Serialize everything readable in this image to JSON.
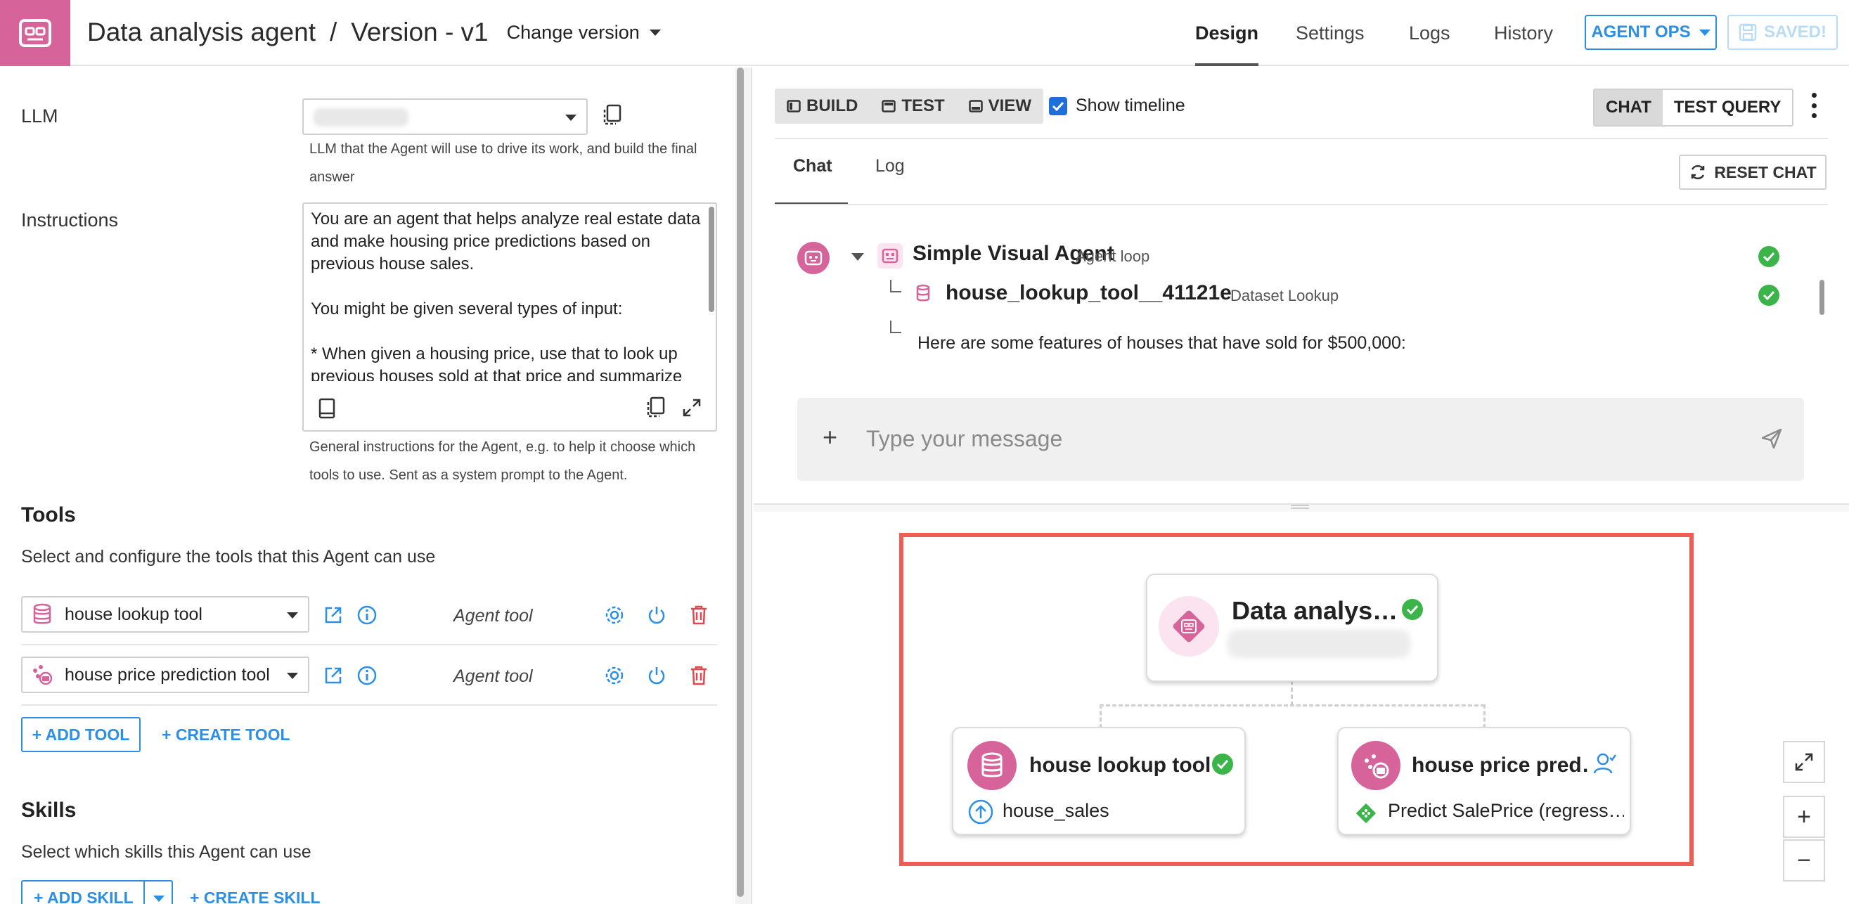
{
  "header": {
    "agent_name": "Data analysis agent",
    "separator": "/",
    "version": "Version - v1",
    "change_version": "Change version",
    "tabs": [
      {
        "label": "Design",
        "active": true
      },
      {
        "label": "Settings",
        "active": false
      },
      {
        "label": "Logs",
        "active": false
      },
      {
        "label": "History",
        "active": false
      }
    ],
    "agent_ops_label": "AGENT OPS",
    "saved_label": "SAVED!"
  },
  "form": {
    "llm_label": "LLM",
    "llm_help": "LLM that the Agent will use to drive its work, and build the final answer",
    "instructions_label": "Instructions",
    "instructions_text": "You are an agent that helps analyze real estate data and make housing price predictions based on previous house sales.\n\nYou might be given several types of input:\n\n* When given a housing price, use that to look up previous houses sold at that price and summarize",
    "instructions_help": "General instructions for the Agent, e.g. to help it choose which tools to use. Sent as a system prompt to the Agent."
  },
  "tools": {
    "title": "Tools",
    "subtitle": "Select and configure the tools that this Agent can use",
    "items": [
      {
        "name": "house lookup tool",
        "type": "Agent tool",
        "icon": "database-icon"
      },
      {
        "name": "house price prediction tool",
        "type": "Agent tool",
        "icon": "prediction-model-icon"
      }
    ],
    "add_tool_label": "+ ADD TOOL",
    "create_tool_label": "+ CREATE TOOL"
  },
  "skills": {
    "title": "Skills",
    "subtitle": "Select which skills this Agent can use",
    "add_skill_label": "+ ADD SKILL",
    "create_skill_label": "+ CREATE SKILL"
  },
  "chat_panel": {
    "modes": [
      {
        "label": "BUILD",
        "icon": "build-icon"
      },
      {
        "label": "TEST",
        "icon": "test-icon"
      },
      {
        "label": "VIEW",
        "icon": "view-icon"
      }
    ],
    "show_timeline_label": "Show timeline",
    "show_timeline_checked": true,
    "chat_toggle": {
      "chat": "CHAT",
      "test_query": "TEST QUERY",
      "selected": "CHAT"
    },
    "subtabs": [
      {
        "label": "Chat",
        "active": true
      },
      {
        "label": "Log",
        "active": false
      }
    ],
    "reset_label": "RESET CHAT",
    "timeline": {
      "agent_title": "Simple Visual Agent",
      "agent_type": "Agent loop",
      "tool_title": "house_lookup_tool__41121e",
      "tool_type": "Dataset Lookup",
      "message": "Here are some features of houses that have sold for $500,000:"
    },
    "composer_placeholder": "Type your message"
  },
  "graph": {
    "root": {
      "title": "Data analys…",
      "status": "success"
    },
    "children": [
      {
        "title": "house lookup tool",
        "status": "success",
        "sub": "house_sales",
        "sub_icon": "upload-circle-icon"
      },
      {
        "title": "house price pred…",
        "status": "user",
        "sub": "Predict SalePrice (regress…",
        "sub_icon": "model-diamond-icon"
      }
    ],
    "zoom": {
      "fit": "fit-view-icon",
      "in": "+",
      "out": "−"
    }
  },
  "colors": {
    "brand_pink": "#d6649b",
    "accent_blue": "#2c8fe3",
    "success_green": "#3bb54a",
    "highlight_red": "#ef5e55",
    "delete_red": "#e0484e"
  }
}
